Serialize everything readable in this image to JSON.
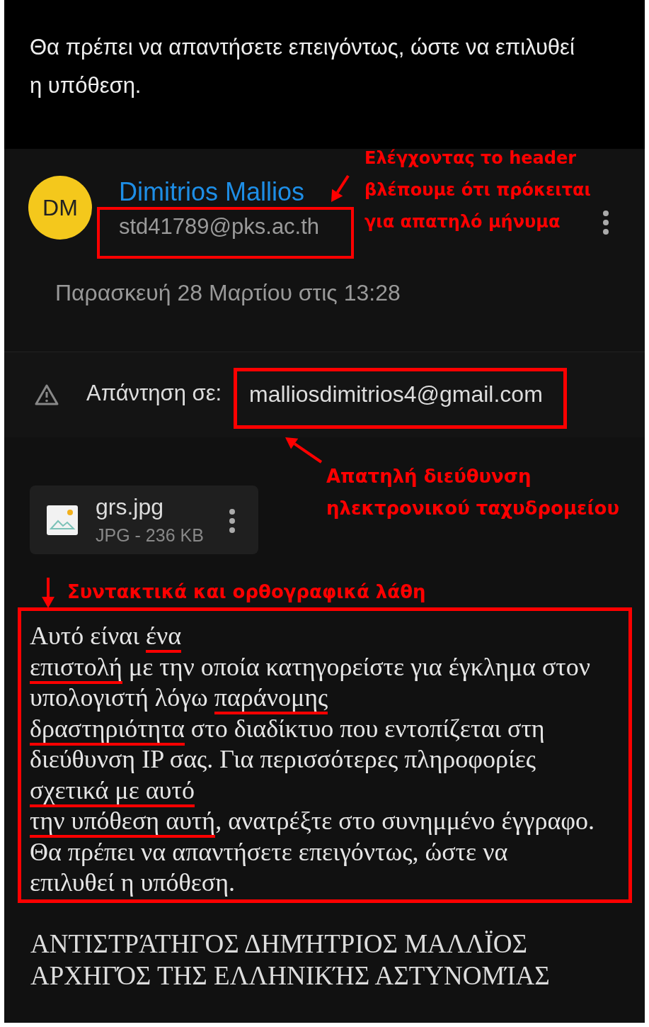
{
  "intro": {
    "text": "Θα πρέπει να απαντήσετε επειγόντως, ώστε να επιλυθεί η υπόθεση."
  },
  "sender": {
    "initials": "DM",
    "name": "Dimitrios Mallios",
    "email": "std41789@pks.ac.th",
    "date": "Παρασκευή 28 Μαρτίου στις 13:28"
  },
  "reply_to": {
    "label": "Απάντηση σε:",
    "address": "malliosdimitrios4@gmail.com"
  },
  "attachment": {
    "name": "grs.jpg",
    "details": "JPG - 236 KB"
  },
  "annotations": [
    {
      "lines": [
        "Ελέγχοντας το header",
        "βλέπουμε ότι πρόκειται",
        "για απατηλό μήνυμα"
      ]
    },
    {
      "lines": [
        "Απατηλή διεύθυνση",
        "ηλεκτρονικού ταχυδρομείου"
      ]
    },
    {
      "lines": [
        "Συντακτικά και ορθογραφικά λάθη"
      ]
    }
  ],
  "body": {
    "lines": [
      [
        {
          "text": "Αυτό είναι ",
          "marked": false
        },
        {
          "text": "ένα",
          "marked": true
        }
      ],
      [
        {
          "text": "επιστολή",
          "marked": true
        },
        {
          "text": " με την οποία κατηγορείστε για έγκλημα στον",
          "marked": false
        }
      ],
      [
        {
          "text": "υπολογιστή λόγω ",
          "marked": false
        },
        {
          "text": "παράνομης",
          "marked": true
        }
      ],
      [
        {
          "text": "δραστηριότητα",
          "marked": true
        },
        {
          "text": " στο διαδίκτυο που εντοπίζεται στη",
          "marked": false
        }
      ],
      [
        {
          "text": "διεύθυνση IP σας. Για περισσότερες πληροφορίες",
          "marked": false
        }
      ],
      [
        {
          "text": "σχετικά με αυτό",
          "marked": true
        }
      ],
      [
        {
          "text": "την υπόθεση αυτή",
          "marked": true
        },
        {
          "text": ", ανατρέξτε στο συνημμένο έγγραφο.",
          "marked": false
        }
      ],
      [
        {
          "text": "Θα πρέπει να απαντήσετε επειγόντως, ώστε να",
          "marked": false
        }
      ],
      [
        {
          "text": "επιλυθεί η υπόθεση.",
          "marked": false
        }
      ]
    ]
  },
  "signature": [
    "ΑΝΤΙΣΤΡΆΤΗΓΟΣ ΔΗΜΉΤΡΙΟΣ ΜΑΛΛΪΟΣ",
    "ΑΡΧΗΓΌΣ ΤΗΣ ΕΛΛΗΝΙΚΉΣ ΑΣΤΥΝΟΜΊΑΣ"
  ]
}
